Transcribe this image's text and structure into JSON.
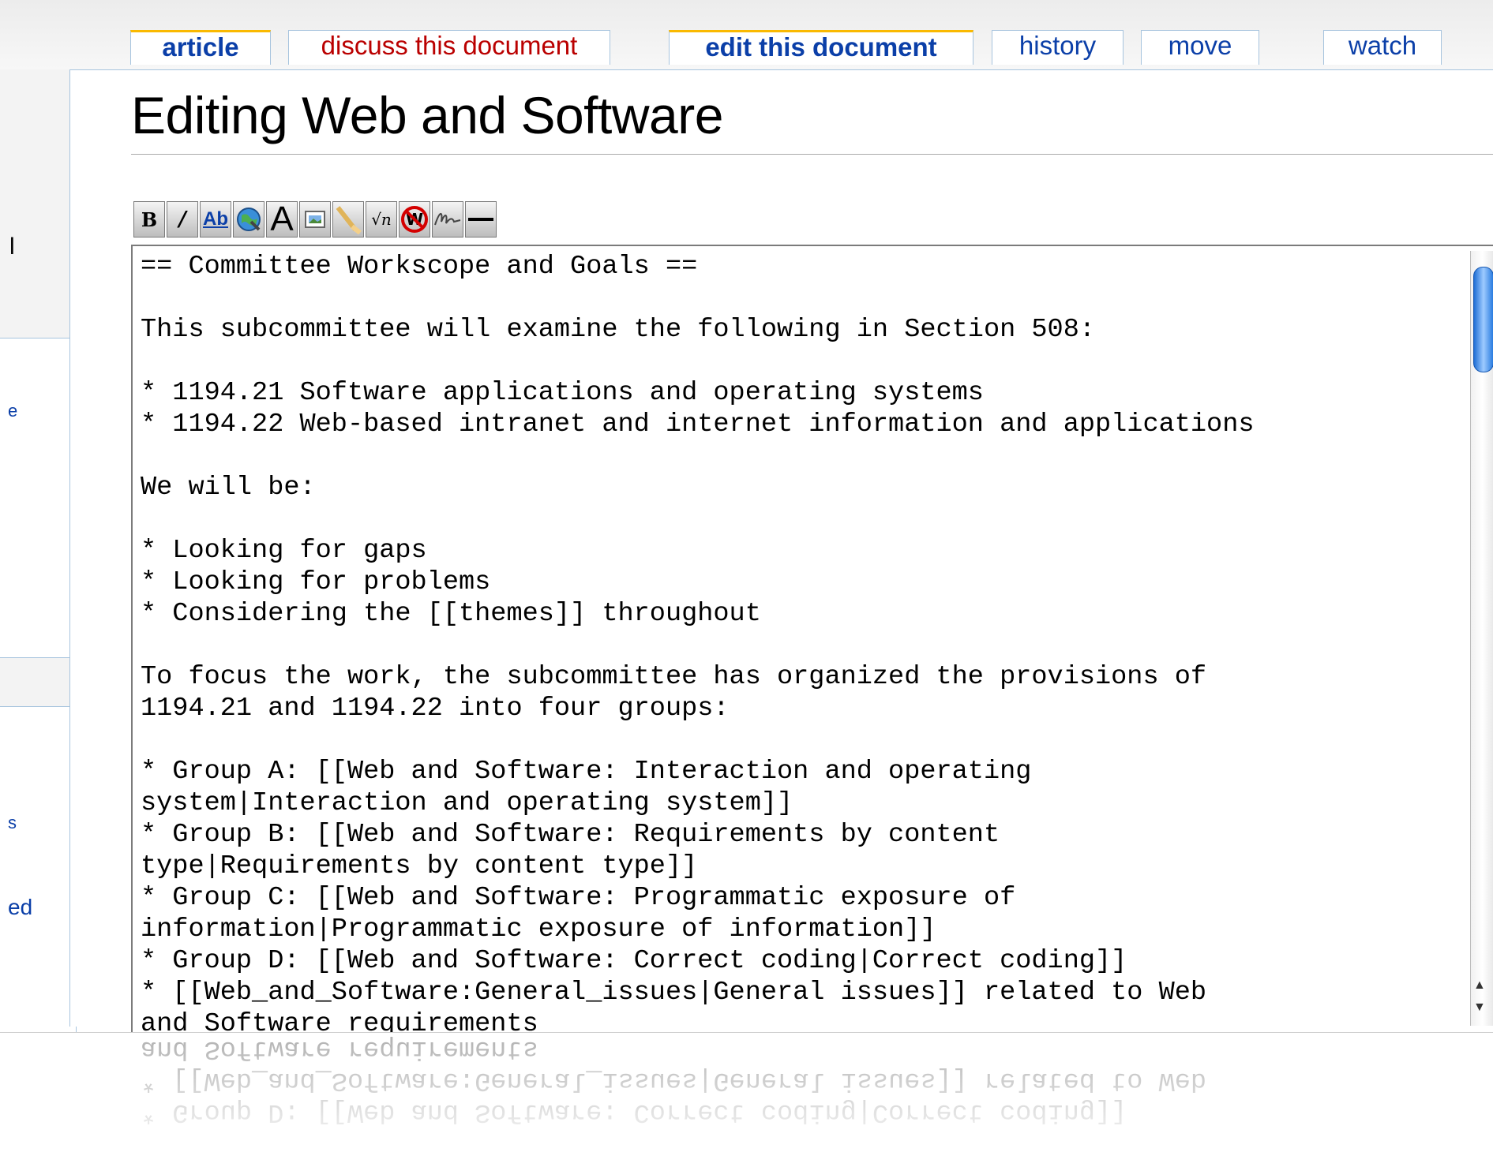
{
  "tabs": [
    {
      "label": "article",
      "selected": true,
      "color": "#0b3fa8"
    },
    {
      "label": "discuss this document",
      "selected": false,
      "color": "#ba0000"
    },
    {
      "label": "edit this document",
      "selected": true,
      "color": "#0b3fa8"
    },
    {
      "label": "history",
      "selected": false,
      "color": "#0b3fa8"
    },
    {
      "label": "move",
      "selected": false,
      "color": "#0b3fa8"
    },
    {
      "label": "watch",
      "selected": false,
      "color": "#0b3fa8"
    }
  ],
  "page": {
    "title": "Editing Web and Software"
  },
  "toolbar": {
    "buttons": [
      {
        "name": "bold-icon",
        "glyph": "B"
      },
      {
        "name": "italic-icon",
        "glyph": "/"
      },
      {
        "name": "internal-link-icon",
        "glyph": "Ab"
      },
      {
        "name": "external-link-icon",
        "glyph": "globe"
      },
      {
        "name": "headline-icon",
        "glyph": "A"
      },
      {
        "name": "embedded-image-icon",
        "glyph": "image"
      },
      {
        "name": "media-file-icon",
        "glyph": "note"
      },
      {
        "name": "math-formula-icon",
        "glyph": "√n"
      },
      {
        "name": "nowiki-icon",
        "glyph": "W"
      },
      {
        "name": "signature-icon",
        "glyph": "sig"
      },
      {
        "name": "horizontal-line-icon",
        "glyph": "—"
      }
    ]
  },
  "editor": {
    "lines": [
      "== Committee Workscope and Goals ==",
      "",
      "This subcommittee will examine the following in Section 508:",
      "",
      "* 1194.21 Software applications and operating systems",
      "* 1194.22 Web-based intranet and internet information and applications",
      "",
      "We will be:",
      "",
      "* Looking for gaps",
      "* Looking for problems",
      "* Considering the [[themes]] throughout",
      "",
      "To focus the work, the subcommittee has organized the provisions of",
      "1194.21 and 1194.22 into four groups:",
      "",
      "* Group A: [[Web and Software: Interaction and operating",
      "system|Interaction and operating system]]",
      "* Group B: [[Web and Software: Requirements by content",
      "type|Requirements by content type]]",
      "* Group C: [[Web and Software: Programmatic exposure of",
      "information|Programmatic exposure of information]]",
      "* Group D: [[Web and Software: Correct coding|Correct coding]]",
      "* [[Web_and_Software:General_issues|General issues]] related to Web",
      "and Software requirements"
    ]
  },
  "sidebar": {
    "fragments": [
      "l",
      "e",
      "s",
      "ed"
    ]
  }
}
